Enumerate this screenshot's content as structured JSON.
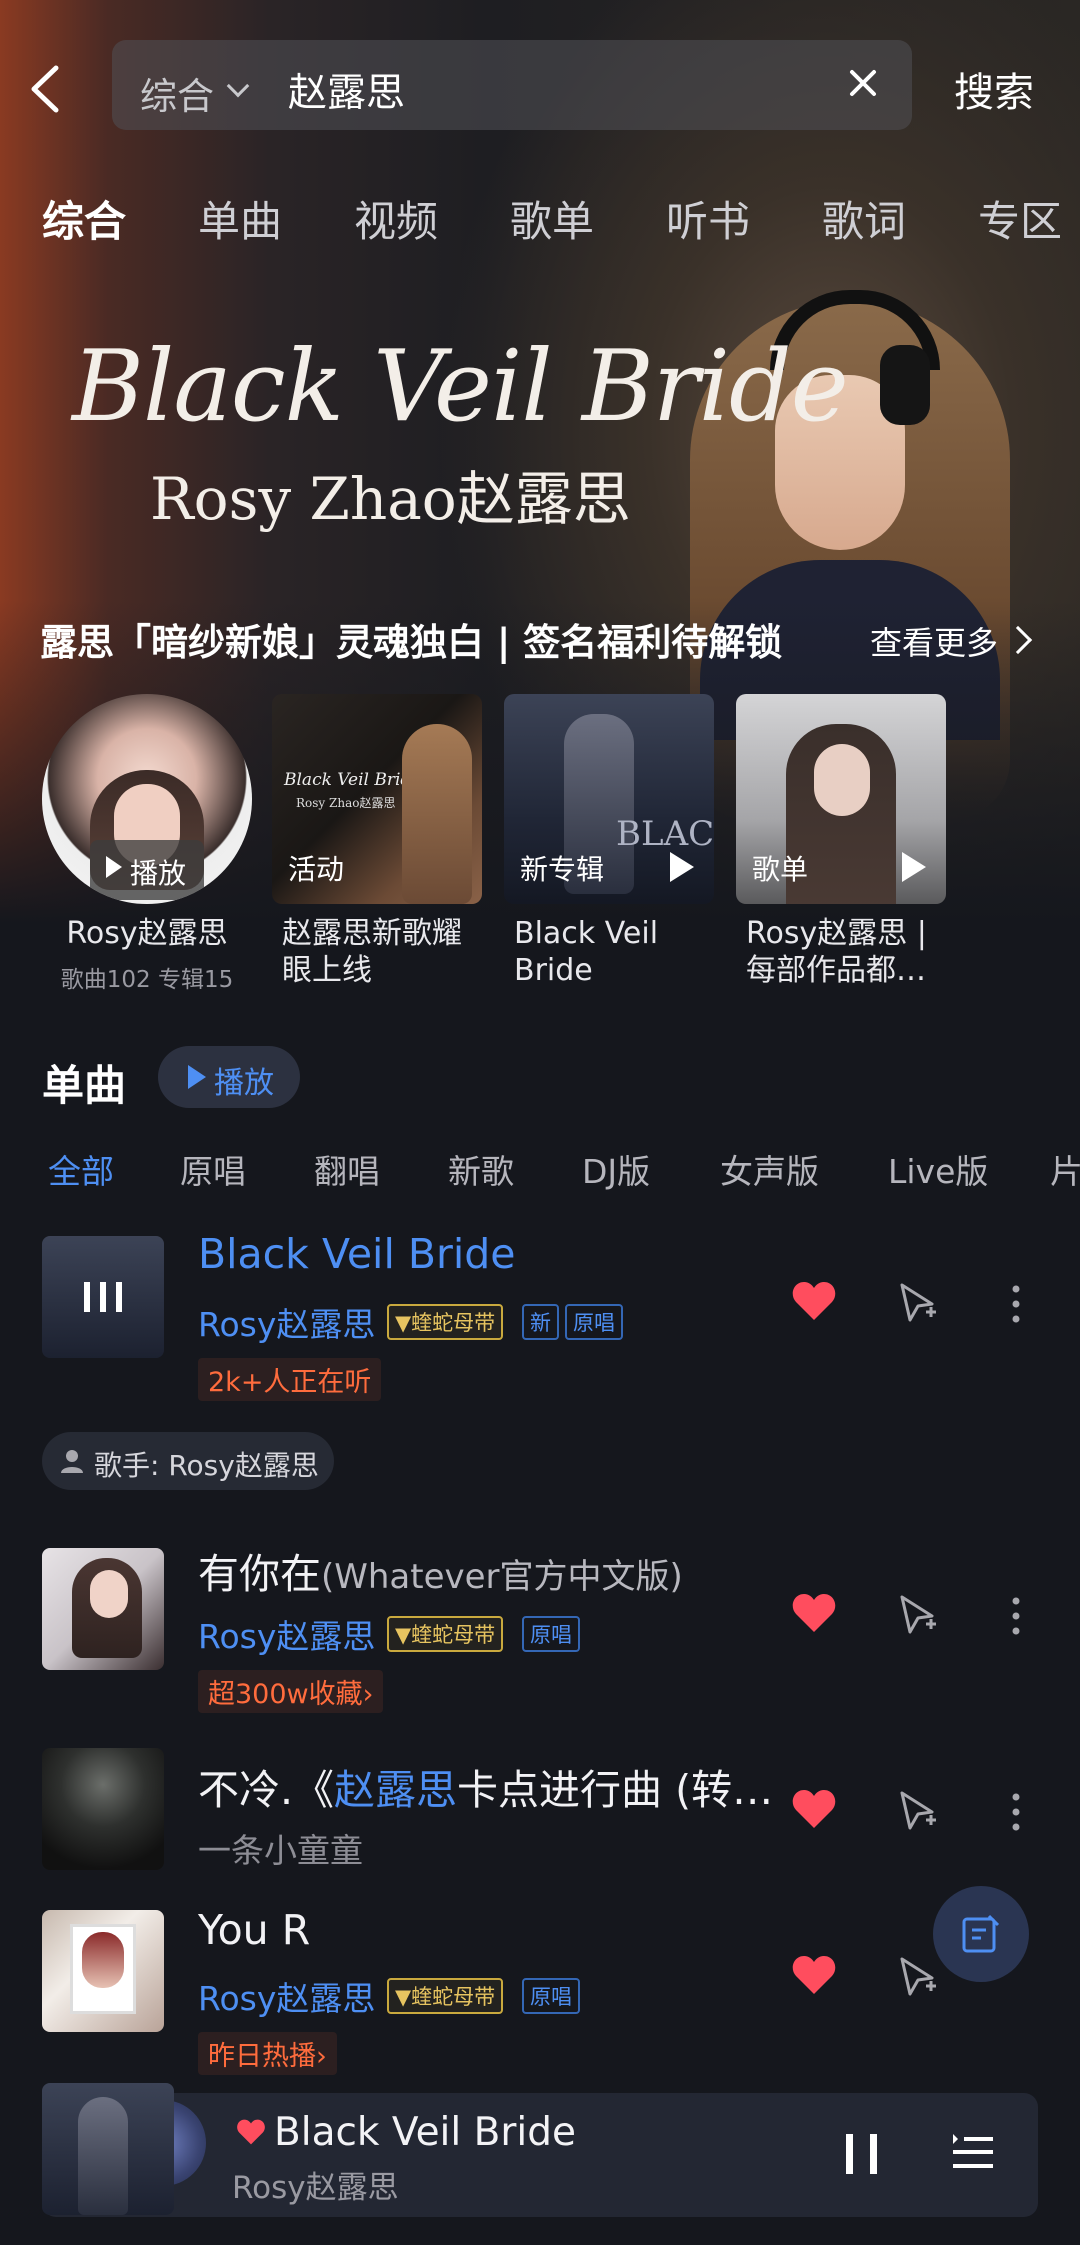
{
  "header": {
    "search_type": "综合",
    "query": "赵露思",
    "search_button": "搜索"
  },
  "tabs": [
    {
      "label": "综合",
      "active": true
    },
    {
      "label": "单曲"
    },
    {
      "label": "视频"
    },
    {
      "label": "歌单"
    },
    {
      "label": "听书"
    },
    {
      "label": "歌词"
    },
    {
      "label": "专区"
    }
  ],
  "banner": {
    "title": "Black Veil Bride",
    "subtitle": "Rosy Zhao赵露思",
    "caption": "露思「暗纱新娘」灵魂独白 | 签名福利待解锁",
    "more": "查看更多"
  },
  "cards": [
    {
      "badge": "播放",
      "title": "Rosy赵露思",
      "meta": "歌曲102 专辑15"
    },
    {
      "badge": "活动",
      "title": "赵露思新歌耀眼上线",
      "cover_title": "Black Veil Bride",
      "cover_sub": "Rosy Zhao赵露思"
    },
    {
      "badge": "新专辑",
      "title": "Black Veil Bride",
      "cover_text": "BLACK"
    },
    {
      "badge": "歌单",
      "title": "Rosy赵露思 | 每部作品都…"
    }
  ],
  "section": {
    "title": "单曲",
    "play": "播放"
  },
  "filters": [
    "全部",
    "原唱",
    "翻唱",
    "新歌",
    "DJ版",
    "女声版",
    "Live版",
    "片"
  ],
  "songs": [
    {
      "title": "Black Veil Bride",
      "artist": "Rosy赵露思",
      "tags": [
        "蝰蛇母带",
        "新",
        "原唱"
      ],
      "extra": "2k+人正在听",
      "playing": true
    },
    {
      "title": "有你在",
      "title_paren": "(Whatever官方中文版)",
      "artist": "Rosy赵露思",
      "tags": [
        "蝰蛇母带",
        "原唱"
      ],
      "extra": "超300w收藏"
    },
    {
      "title_pre": "不冷.《",
      "title_hl": "赵露思",
      "title_post": "卡点进行曲 (转…",
      "artist": "一条小童童"
    },
    {
      "title": "You R",
      "artist": "Rosy赵露思",
      "tags": [
        "蝰蛇母带",
        "原唱"
      ],
      "extra": "昨日热播"
    }
  ],
  "singer_chip": "歌手: Rosy赵露思",
  "player": {
    "title": "Black Veil Bride",
    "artist": "Rosy赵露思"
  },
  "colors": {
    "accent": "#4e8ff3",
    "heart": "#ff4d5e",
    "hot": "#ff6c3d",
    "gold": "#e7c460",
    "background": "#15171d"
  }
}
